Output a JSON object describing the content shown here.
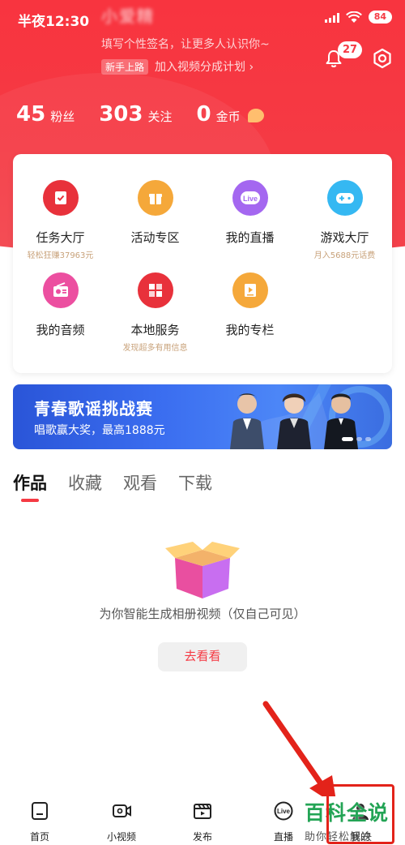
{
  "status_bar": {
    "time": "半夜12:30",
    "battery": "84"
  },
  "profile": {
    "name": "小爱精",
    "signature": "填写个性签名，让更多人认识你~",
    "creator_badge": "新手上路",
    "creator_link": "加入视频分成计划 ›",
    "notification_count": "27"
  },
  "stats": [
    {
      "value": "45",
      "label": "粉丝"
    },
    {
      "value": "303",
      "label": "关注"
    },
    {
      "value": "0",
      "label": "金币"
    }
  ],
  "services": [
    {
      "label": "任务大厅",
      "sub": "轻松狂赚37963元",
      "icon": "task-icon",
      "color": "#e8313b"
    },
    {
      "label": "活动专区",
      "sub": "",
      "icon": "gift-icon",
      "color": "#f5a83a"
    },
    {
      "label": "我的直播",
      "sub": "",
      "icon": "live-icon",
      "color": "#a467f0"
    },
    {
      "label": "游戏大厅",
      "sub": "月入5688元话费",
      "icon": "gamepad-icon",
      "color": "#35b8f2"
    },
    {
      "label": "我的音频",
      "sub": "",
      "icon": "radio-icon",
      "color": "#ec4fa0"
    },
    {
      "label": "本地服务",
      "sub": "发现超多有用信息",
      "icon": "local-service-icon",
      "color": "#e8313b"
    },
    {
      "label": "我的专栏",
      "sub": "",
      "icon": "column-icon",
      "color": "#f5a83a"
    }
  ],
  "banner": {
    "title": "青春歌谣挑战赛",
    "subtitle": "唱歌赢大奖，最高1888元"
  },
  "tabs": [
    {
      "label": "作品",
      "active": true
    },
    {
      "label": "收藏",
      "active": false
    },
    {
      "label": "观看",
      "active": false
    },
    {
      "label": "下载",
      "active": false
    }
  ],
  "empty_state": {
    "text": "为你智能生成相册视频（仅自己可见）",
    "button": "去看看"
  },
  "bottom_nav": [
    {
      "label": "首页",
      "icon": "home-icon"
    },
    {
      "label": "小视频",
      "icon": "video-icon"
    },
    {
      "label": "发布",
      "icon": "publish-icon"
    },
    {
      "label": "直播",
      "icon": "live-icon"
    },
    {
      "label": "我的",
      "icon": "profile-icon"
    }
  ],
  "watermark": {
    "title": "百科全说",
    "subtitle": "助你轻松解决"
  }
}
